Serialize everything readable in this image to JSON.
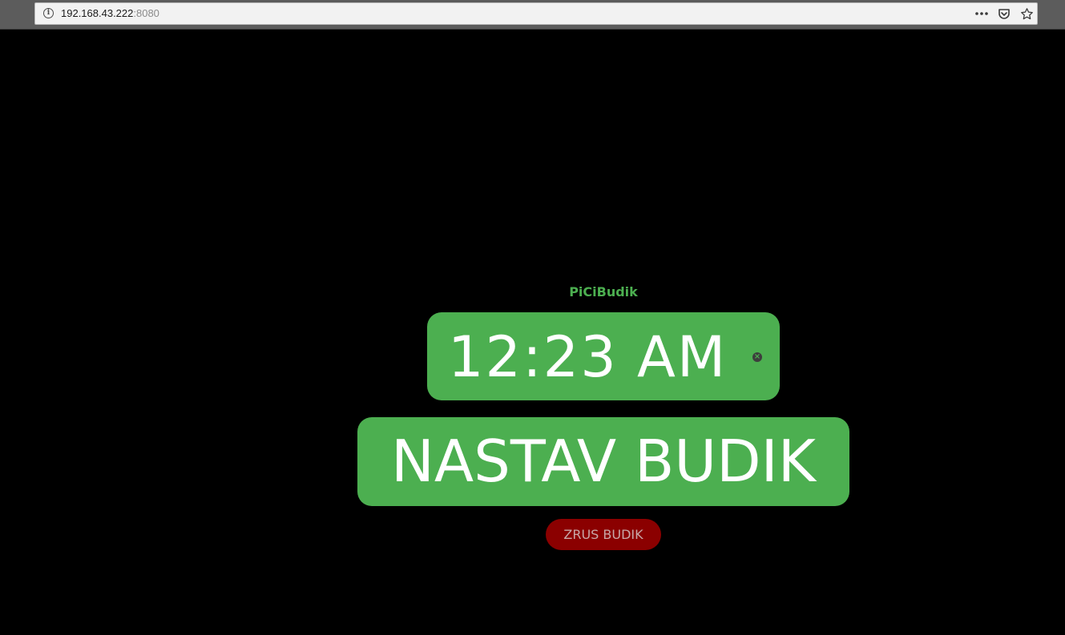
{
  "browser": {
    "url_host": "192.168.43.222",
    "url_port": ":8080",
    "actions": [
      {
        "name": "page-actions-menu-icon",
        "glyph": "•••"
      },
      {
        "name": "pocket-icon",
        "glyph": ""
      },
      {
        "name": "bookmark-star-icon",
        "glyph": "☆"
      }
    ]
  },
  "app": {
    "title": "PiCiBudik",
    "time_value": "12:23 AM",
    "set_alarm_label": "NASTAV BUDIK",
    "cancel_alarm_label": "ZRUS BUDIK"
  },
  "colors": {
    "accent": "#4caf50",
    "danger": "#8b0000",
    "background": "#000000"
  }
}
